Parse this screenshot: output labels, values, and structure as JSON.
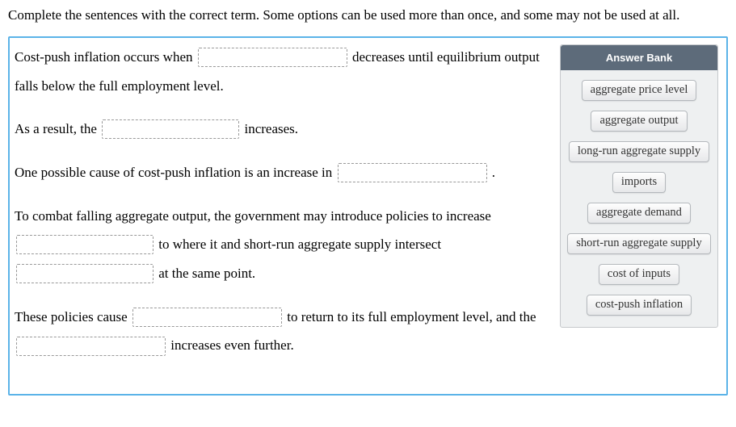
{
  "instructions": "Complete the sentences with the correct term. Some options can be used more than once, and some may not be used at all.",
  "question": {
    "p1a": "Cost-push inflation occurs when ",
    "p1b": " decreases until equilibrium output falls below the full employment level.",
    "p2a": "As a result, the ",
    "p2b": " increases.",
    "p3a": "One possible cause of cost-push inflation is an increase in ",
    "p3b": " .",
    "p4a": "To combat falling aggregate output, the government may introduce policies to increase ",
    "p4b": " to where it and short-run aggregate supply intersect ",
    "p4c": " at the same point.",
    "p5a": "These policies cause ",
    "p5b": " to return to its full employment level, and the ",
    "p5c": " increases even further."
  },
  "answerBank": {
    "title": "Answer Bank",
    "items": [
      "aggregate price level",
      "aggregate output",
      "long-run aggregate supply",
      "imports",
      "aggregate demand",
      "short-run aggregate supply",
      "cost of inputs",
      "cost-push inflation"
    ]
  }
}
